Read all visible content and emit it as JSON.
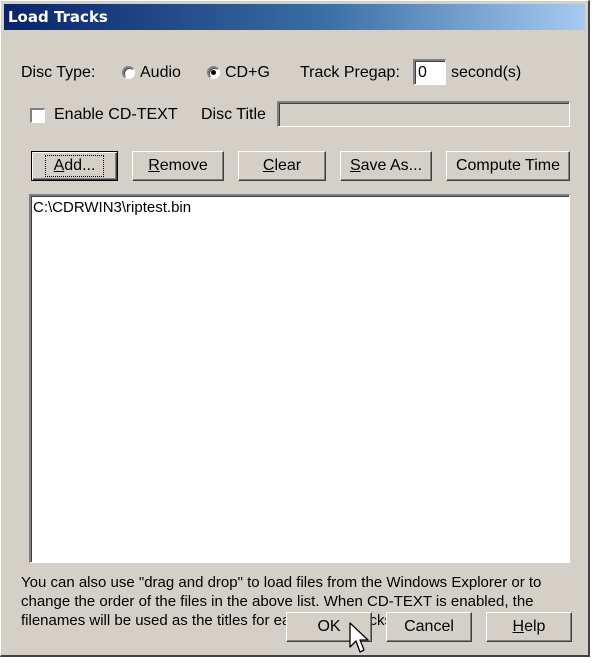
{
  "window": {
    "title": "Load Tracks"
  },
  "disc_type": {
    "label": "Disc Type:",
    "options": [
      "Audio",
      "CD+G"
    ],
    "selected": "CD+G"
  },
  "pregap": {
    "label": "Track Pregap:",
    "value": "0",
    "unit": "second(s)"
  },
  "cdtext": {
    "label": "Enable CD-TEXT",
    "checked": false
  },
  "disc_title": {
    "label": "Disc Title",
    "value": ""
  },
  "toolbar": {
    "add": {
      "pre": "",
      "key": "A",
      "post": "dd..."
    },
    "remove": {
      "pre": "",
      "key": "R",
      "post": "emove"
    },
    "clear": {
      "pre": "",
      "key": "C",
      "post": "lear"
    },
    "save_as": {
      "pre": "",
      "key": "S",
      "post": "ave As..."
    },
    "compute_time": "Compute Time"
  },
  "files": [
    "C:\\CDRWIN3\\riptest.bin"
  ],
  "info_text": "You can also use \"drag and drop\" to load files from the Windows Explorer or to change the order of the files in the above list. When CD-TEXT is enabled, the filenames will be used as the titles for each of the tracks.",
  "footer": {
    "ok": "OK",
    "cancel": "Cancel",
    "help": {
      "pre": "",
      "key": "H",
      "post": "elp"
    }
  },
  "icons": {
    "cursor": "arrow-cursor-icon"
  }
}
